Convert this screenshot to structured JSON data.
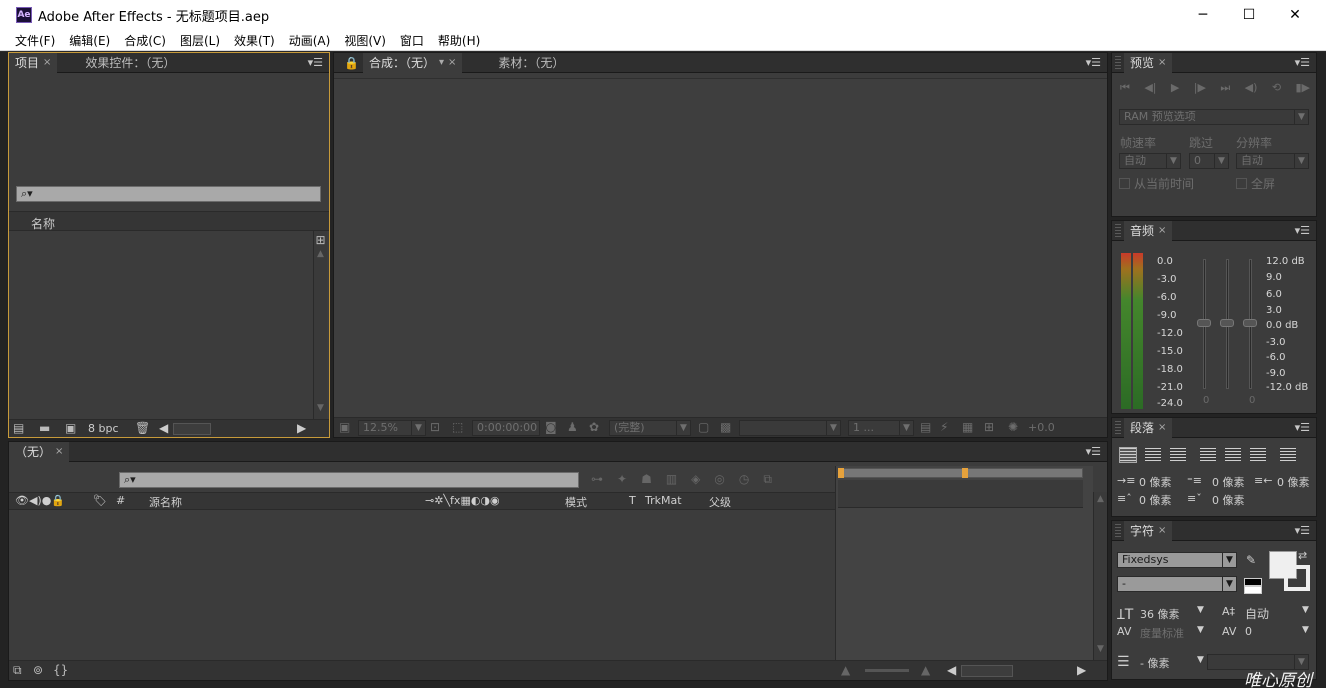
{
  "window": {
    "app_icon_text": "Ae",
    "title": "Adobe After Effects - 无标题项目.aep",
    "min_glyph": "─",
    "max_glyph": "☐",
    "close_glyph": "✕"
  },
  "menu": [
    "文件(F)",
    "编辑(E)",
    "合成(C)",
    "图层(L)",
    "效果(T)",
    "动画(A)",
    "视图(V)",
    "窗口",
    "帮助(H)"
  ],
  "project_panel": {
    "tab_project": "项目",
    "tab_effects": "效果控件：（无）",
    "search_placeholder": "⌕▾",
    "column_name": "名称",
    "bpc": "8 bpc"
  },
  "comp_panel": {
    "tab_comp": "合成：（无）",
    "tab_footage": "素材：（无）",
    "zoom": "12.5%",
    "timecode": "0:00:00:00",
    "resolution": "(完整)",
    "view": "1 ...",
    "exposure": "+0.0"
  },
  "preview_panel": {
    "tab": "预览",
    "ram_options": "RAM 预览选项",
    "frame_rate_label": "帧速率",
    "skip_label": "跳过",
    "resolution_label": "分辨率",
    "frame_rate_value": "自动",
    "skip_value": "0",
    "resolution_value": "自动",
    "from_current": "从当前时间",
    "fullscreen": "全屏"
  },
  "audio_panel": {
    "tab": "音频",
    "left_scale": [
      "0.0",
      "-3.0",
      "-6.0",
      "-9.0",
      "-12.0",
      "-15.0",
      "-18.0",
      "-21.0",
      "-24.0"
    ],
    "right_scale": [
      "12.0 dB",
      "9.0",
      "6.0",
      "3.0",
      "0.0 dB",
      "-3.0",
      "-6.0",
      "-9.0",
      "-12.0 dB"
    ],
    "left_value": "0",
    "right_value": "0"
  },
  "paragraph_panel": {
    "tab": "段落",
    "indent_left": "0 像素",
    "indent_first": "0 像素",
    "indent_right": "0 像素",
    "space_before": "0 像素",
    "space_after": "0 像素"
  },
  "character_panel": {
    "tab": "字符",
    "font": "Fixedsys",
    "style": "-",
    "size": "36 像素",
    "leading": "自动",
    "kerning": "度量标准",
    "tracking": "0",
    "stroke_width": "- 像素"
  },
  "timeline_panel": {
    "tab": "（无）",
    "search_placeholder": "⌕▾",
    "col_number": "#",
    "col_source": "源名称",
    "col_mode": "模式",
    "col_t": "T",
    "col_trkmat": "TrkMat",
    "col_parent": "父级"
  },
  "watermark": "唯心原创",
  "colors": {
    "accent_orange": "#e6a23c",
    "panel_bg": "#3c3c3c",
    "focus_border": "#c79a3a"
  }
}
